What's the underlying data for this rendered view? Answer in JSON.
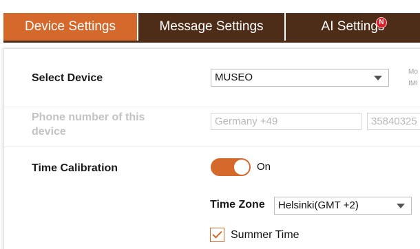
{
  "tabs": [
    {
      "label": "Device Settings",
      "active": true
    },
    {
      "label": "Message Settings",
      "active": false
    },
    {
      "label": "AI Settings",
      "active": false,
      "badge": "N"
    }
  ],
  "device": {
    "label": "Select Device",
    "selected": "MUSEO",
    "side_note_line1": "Mo",
    "side_note_line2": "IMI"
  },
  "phone": {
    "label": "Phone number of this device",
    "country_placeholder": "Germany +49",
    "number_value": "35840325"
  },
  "calibration": {
    "label": "Time Calibration",
    "toggle_on": true,
    "toggle_text": "On",
    "timezone_label": "Time Zone",
    "timezone_value": "Helsinki(GMT +2)",
    "summer_time_label": "Summer Time",
    "summer_time_checked": true
  },
  "colors": {
    "accent": "#d5692b",
    "tab_dark": "#4e2d18",
    "badge": "#d9202a"
  }
}
